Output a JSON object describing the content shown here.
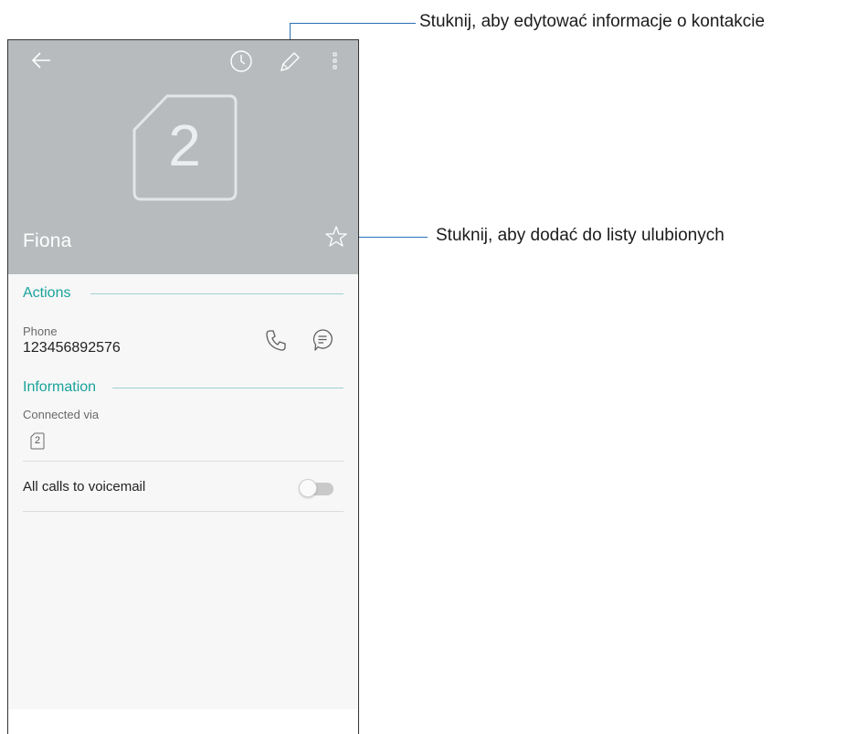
{
  "contact": {
    "sim_number": "2",
    "name": "Fiona"
  },
  "toolbar": {
    "icons": [
      "back-arrow-icon",
      "history-clock-icon",
      "edit-pencil-icon",
      "more-vert-icon"
    ]
  },
  "actions": {
    "heading": "Actions",
    "phone_label": "Phone",
    "phone_number": "123456892576"
  },
  "information": {
    "heading": "Information",
    "connected_label": "Connected via",
    "sim_badge": "2"
  },
  "voicemail": {
    "label": "All calls to voicemail",
    "enabled": false
  },
  "annotations": {
    "edit": "Stuknij, aby edytować informacje o kontakcie",
    "favorite": "Stuknij, aby dodać do listy ulubionych"
  },
  "colors": {
    "header_bg": "#b7bbbd",
    "accent": "#19a29a",
    "annotation_line": "#2b6fb5"
  }
}
